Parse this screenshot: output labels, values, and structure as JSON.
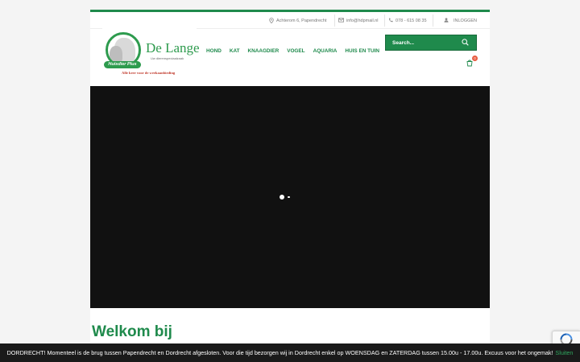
{
  "topbar": {
    "address": "Achterom 6, Papendrecht",
    "email": "info@hdpmail.nl",
    "phone": "078 - 615 08 35",
    "login": "INLOGGEN"
  },
  "logo": {
    "name": "De Lange",
    "tagline": "Uw dierenspeciaalzaak",
    "badge": "Huisdier Plus",
    "slogan": "Alle keer voor de weekaanbieding"
  },
  "nav": {
    "items": [
      "HOND",
      "KAT",
      "KNAAGDIER",
      "VOGEL",
      "AQUARIA",
      "HUIS EN TUIN"
    ]
  },
  "search": {
    "placeholder": "Search..."
  },
  "cart": {
    "count": "0"
  },
  "main": {
    "welcome_heading": "Welkom bij"
  },
  "notice": {
    "text": "DORDRECHT! Momenteel is de brug tussen Papendrecht en Dordrecht afgesloten. Voor die tijd bezorgen wij in Dordrecht enkel op WOENSDAG en ZATERDAG tussen 15.00u - 17.00u. Excuus voor het ongemak!",
    "dismiss": "Sluiten"
  },
  "colors": {
    "brand_green": "#1f8a4c",
    "notice_bg": "#1a1a1a",
    "slider_bg": "#111111",
    "badge_red": "#e85c41"
  },
  "icons": [
    "map-pin-icon",
    "envelope-icon",
    "phone-icon",
    "user-icon",
    "search-icon",
    "cart-icon",
    "recaptcha-icon"
  ]
}
